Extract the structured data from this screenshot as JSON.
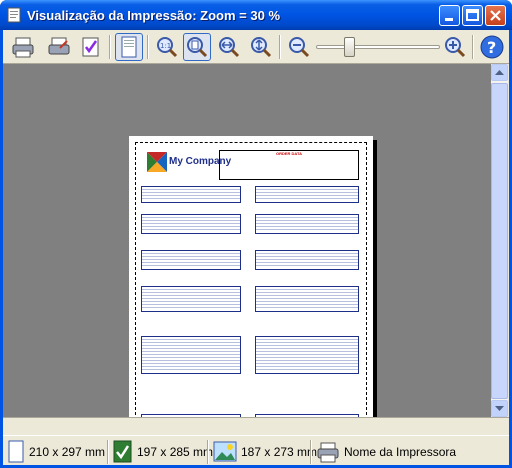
{
  "window": {
    "title": "Visualização da Impressão: Zoom = 30 %"
  },
  "toolbar": {
    "tools": [
      "print-icon",
      "print-setup-icon",
      "print-check-icon",
      "single-page-icon",
      "zoom-100-icon",
      "zoom-page-icon",
      "zoom-width-icon",
      "zoom-height-icon",
      "zoom-out-icon",
      "zoom-in-icon",
      "help-icon"
    ]
  },
  "zoom": {
    "level": 30
  },
  "document": {
    "company": "My Company",
    "invoice_header": "ORDER DATA"
  },
  "status": {
    "paper_size": "210 x 297 mm",
    "printable_size": "197 x 285 mm",
    "image_size": "187 x 273 mm",
    "printer": "Nome da Impressora"
  }
}
